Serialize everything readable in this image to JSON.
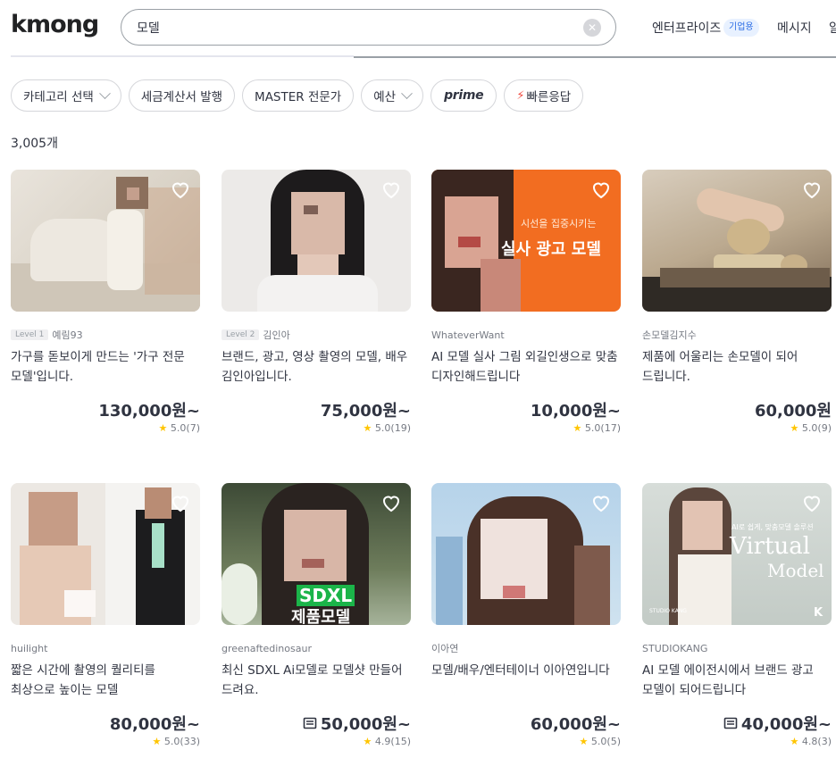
{
  "header": {
    "logo": "kmong",
    "search_value": "모델",
    "clear_icon": "x-circle-icon",
    "enterprise_label": "엔터프라이즈",
    "enterprise_badge": "기업용",
    "message_label": "메시지",
    "cut_label": "알"
  },
  "filters": {
    "category": "카테고리 선택",
    "tax_invoice": "세금계산서 발행",
    "master": "MASTER 전문가",
    "budget": "예산",
    "prime": "prime",
    "fast_response": "빠른응답"
  },
  "results_count": "3,005개",
  "colors": {
    "star": "#ffc500",
    "bolt": "#f04a3f",
    "badge_bg": "#e8f1ff",
    "badge_text": "#2b6de5",
    "orange_banner": "#f26d21"
  },
  "cards": [
    {
      "level": "Level 1",
      "seller": "예림93",
      "title": "가구를 돋보이게 만드는 '가구 전문 모델'입니다.",
      "price": "130,000원~",
      "rating": "5.0",
      "reviews": "(7)",
      "coupon": false
    },
    {
      "level": "Level 2",
      "seller": "김인아",
      "title": "브랜드, 광고, 영상 촬영의 모델, 배우 김인아입니다.",
      "price": "75,000원~",
      "rating": "5.0",
      "reviews": "(19)",
      "coupon": false
    },
    {
      "level": "",
      "seller": "WhateverWant",
      "title": "AI 모델 실사 그림 외길인생으로 맞춤 디자인해드립니다",
      "price": "10,000원~",
      "rating": "5.0",
      "reviews": "(17)",
      "coupon": false,
      "banner_small": "시선을 집중시키는",
      "banner_big": "실사 광고 모델"
    },
    {
      "level": "",
      "seller": "손모델김지수",
      "title": "제품에 어울리는 손모델이 되어 드립니다.",
      "price": "60,000원",
      "rating": "5.0",
      "reviews": "(9)",
      "coupon": false
    },
    {
      "level": "",
      "seller": "huilight",
      "title": "짧은 시간에 촬영의 퀄리티를 최상으로 높이는 모델",
      "price": "80,000원~",
      "rating": "5.0",
      "reviews": "(33)",
      "coupon": false
    },
    {
      "level": "",
      "seller": "greenaftedinosaur",
      "title": "최신 SDXL Ai모델로 모델샷 만들어 드려요.",
      "price": "50,000원~",
      "rating": "4.9",
      "reviews": "(15)",
      "coupon": true,
      "banner_top": "SDXL",
      "banner_bottom": "제품모델"
    },
    {
      "level": "",
      "seller": "이아연",
      "title": "모델/배우/엔터테이너 이아연입니다",
      "price": "60,000원~",
      "rating": "5.0",
      "reviews": "(5)",
      "coupon": false
    },
    {
      "level": "",
      "seller": "STUDIOKANG",
      "title": "AI 모델 에이전시에서 브랜드 광고 모델이 되어드립니다",
      "price": "40,000원~",
      "rating": "4.8",
      "reviews": "(3)",
      "coupon": true,
      "banner_small": "AI로 쉽게, 맞춤모델 솔루션",
      "banner_big1": "Virtual",
      "banner_big2": "Model",
      "banner_studio": "STUDIO KANG",
      "banner_k": "K"
    }
  ]
}
